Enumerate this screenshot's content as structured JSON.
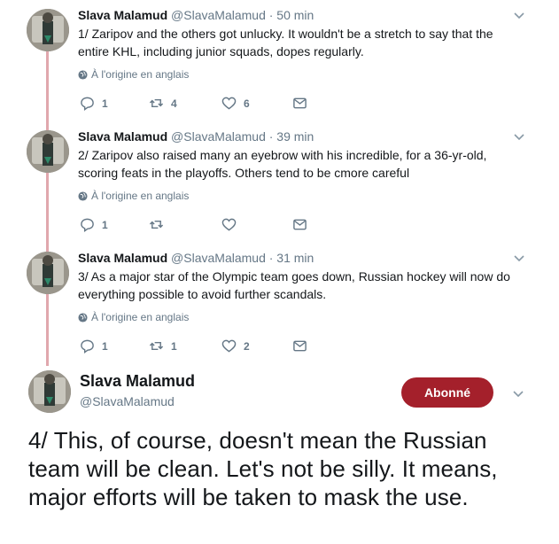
{
  "thread": [
    {
      "name": "Slava Malamud",
      "handle": "@SlavaMalamud",
      "time": "· 50 min",
      "text": "1/ Zaripov and the others got unlucky. It wouldn't be a stretch to say that the entire KHL, including junior squads, dopes regularly.",
      "translate": "À l'origine en anglais",
      "replies": "1",
      "retweets": "4",
      "likes": "6"
    },
    {
      "name": "Slava Malamud",
      "handle": "@SlavaMalamud",
      "time": "· 39 min",
      "text": "2/ Zaripov also raised many an eyebrow with his incredible, for a 36-yr-old, scoring feats in the playoffs. Others tend to be cmore careful",
      "translate": "À l'origine en anglais",
      "replies": "1",
      "retweets": "",
      "likes": ""
    },
    {
      "name": "Slava Malamud",
      "handle": "@SlavaMalamud",
      "time": "· 31 min",
      "text": "3/ As a major star of the Olympic team goes down, Russian hockey will now do everything possible to avoid further scandals.",
      "translate": "À l'origine en anglais",
      "replies": "1",
      "retweets": "1",
      "likes": "2"
    }
  ],
  "main": {
    "name": "Slava Malamud",
    "handle": "@SlavaMalamud",
    "follow_label": "Abonné",
    "text": "4/ This, of course, doesn't mean the Russian team will be clean. Let's not be silly. It means, major efforts will be taken to mask the use."
  },
  "colors": {
    "thread_line": "#e0a7ad",
    "follow_button": "#a4202b",
    "secondary_text": "#657786"
  },
  "icons": [
    "reply-icon",
    "retweet-icon",
    "like-icon",
    "message-icon",
    "globe-icon",
    "chevron-down-icon"
  ]
}
